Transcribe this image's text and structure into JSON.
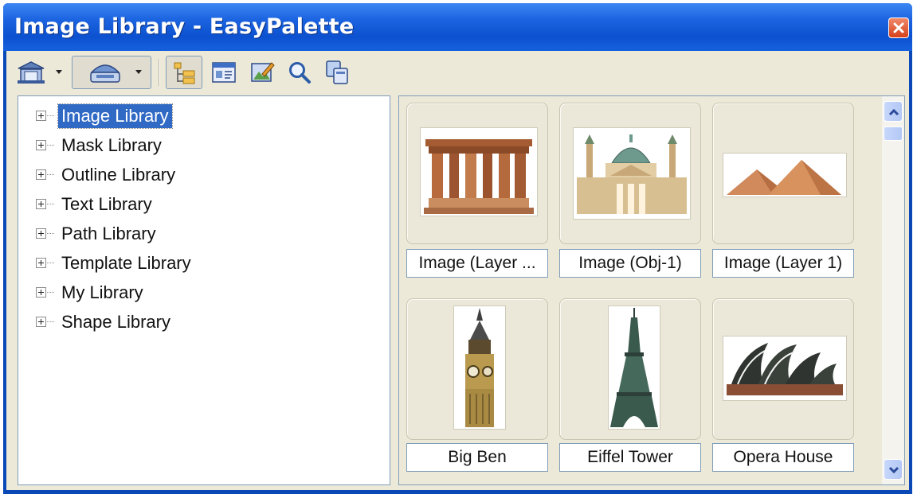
{
  "window": {
    "title": "Image Library - EasyPalette",
    "title_color": "#ffffff",
    "titlebar_color": "#0c52d0"
  },
  "toolbar": {
    "buttons": [
      {
        "icon": "library-home-icon",
        "has_dropdown": true
      },
      {
        "icon": "library-drive-icon",
        "has_dropdown": true,
        "pressed": true
      },
      {
        "icon": "tree-view-icon",
        "pressed": true
      },
      {
        "icon": "details-view-icon"
      },
      {
        "icon": "edit-image-icon"
      },
      {
        "icon": "search-icon"
      },
      {
        "icon": "copy-pages-icon"
      }
    ]
  },
  "tree": {
    "items": [
      {
        "label": "Image Library",
        "selected": true
      },
      {
        "label": "Mask Library"
      },
      {
        "label": "Outline Library"
      },
      {
        "label": "Text Library"
      },
      {
        "label": "Path Library"
      },
      {
        "label": "Template Library"
      },
      {
        "label": "My Library"
      },
      {
        "label": "Shape Library"
      }
    ],
    "selection_color": "#316ac5"
  },
  "gallery": {
    "tiles": [
      {
        "caption": "Image (Layer ...",
        "image": "temple-ruins"
      },
      {
        "caption": "Image (Obj-1)",
        "image": "baroque-church"
      },
      {
        "caption": "Image (Layer 1)",
        "image": "pyramids"
      },
      {
        "caption": "Big Ben",
        "image": "big-ben"
      },
      {
        "caption": "Eiffel Tower",
        "image": "eiffel-tower"
      },
      {
        "caption": "Opera House",
        "image": "opera-house"
      }
    ]
  },
  "scrollbar": {
    "up_icon": "chevron-up-icon",
    "down_icon": "chevron-down-icon"
  }
}
